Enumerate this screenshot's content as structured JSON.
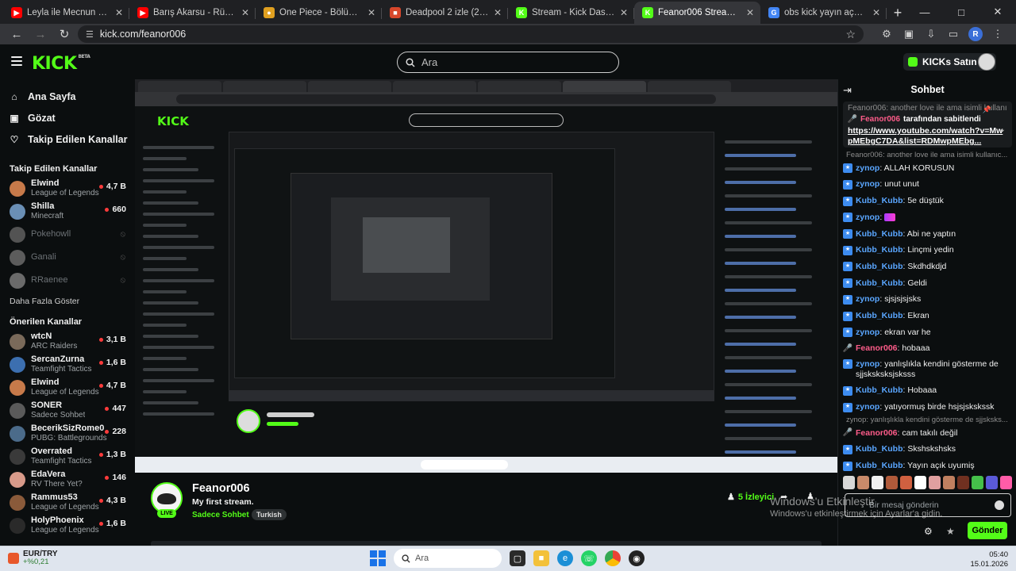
{
  "browser": {
    "tabs": [
      {
        "title": "Leyla ile Mecnun 67. Bölüm - Yo",
        "icon": "youtube",
        "color": "#ff0000"
      },
      {
        "title": "Barış Akarsu - Rüzgar - You",
        "icon": "youtube",
        "color": "#ff0000"
      },
      {
        "title": "One Piece - Bölüm 1170 - Rüyı",
        "icon": "anime",
        "color": "#e0a020"
      },
      {
        "title": "Deadpool 2 izle (2018) | HDFilm",
        "icon": "film",
        "color": "#d8472b"
      },
      {
        "title": "Stream - Kick Dashboard",
        "icon": "kick",
        "color": "#53fc18"
      },
      {
        "title": "Feanor006 Stream - Watch Live",
        "icon": "kick",
        "color": "#53fc18",
        "active": true
      },
      {
        "title": "obs kick yayın açma - Google'd",
        "icon": "google",
        "color": "#4285f4"
      }
    ],
    "url": "kick.com/feanor006",
    "profile_initial": "R"
  },
  "header": {
    "logo": "KICK",
    "logo_beta": "BETA",
    "search_placeholder": "Ara",
    "buy_kicks": "KICKs Satın Al"
  },
  "sidebar": {
    "nav": [
      {
        "label": "Ana Sayfa",
        "icon": "home-icon"
      },
      {
        "label": "Gözat",
        "icon": "browse-icon"
      },
      {
        "label": "Takip Edilen Kanallar",
        "icon": "heart-icon"
      }
    ],
    "followed_header": "Takip Edilen Kanallar",
    "followed": [
      {
        "name": "Elwind",
        "game": "League of Legends",
        "viewers": "4,7 B",
        "color": "#c77a4a"
      },
      {
        "name": "Shilla",
        "game": "Minecraft",
        "viewers": "660",
        "color": "#6a8fb5"
      },
      {
        "name": "Pokehowll",
        "offline": true,
        "color": "#8a8a8a"
      },
      {
        "name": "Ganali",
        "offline": true,
        "color": "#9a9a9a"
      },
      {
        "name": "RRaenee",
        "offline": true,
        "color": "#b0b0b0"
      }
    ],
    "show_more": "Daha Fazla Göster",
    "recommended_header": "Önerilen Kanallar",
    "recommended": [
      {
        "name": "wtcN",
        "game": "ARC Raiders",
        "viewers": "3,1 B",
        "color": "#7a6a5a"
      },
      {
        "name": "SercanZurna",
        "game": "Teamfight Tactics",
        "viewers": "1,6 B",
        "color": "#3c6fb0"
      },
      {
        "name": "Elwind",
        "game": "League of Legends",
        "viewers": "4,7 B",
        "color": "#c77a4a"
      },
      {
        "name": "SONER",
        "game": "Sadece Sohbet",
        "viewers": "447",
        "color": "#5a5a5a"
      },
      {
        "name": "BecerikSizRome0",
        "game": "PUBG: Battlegrounds",
        "viewers": "228",
        "color": "#4b6b8a"
      },
      {
        "name": "Overrated",
        "game": "Teamfight Tactics",
        "viewers": "1,3 B",
        "color": "#3a3a3a"
      },
      {
        "name": "EdaVera",
        "game": "RV There Yet?",
        "viewers": "146",
        "color": "#d89a8a"
      },
      {
        "name": "Rammus53",
        "game": "League of Legends",
        "viewers": "4,3 B",
        "color": "#8a5a3a"
      },
      {
        "name": "HolyPhoenix",
        "game": "League of Legends",
        "viewers": "1,6 B",
        "color": "#2a2a2a"
      }
    ]
  },
  "stream": {
    "streamer": "Feanor006",
    "title": "My first stream.",
    "category": "Sadece Sohbet",
    "tag": "Turkish",
    "live": "LIVE",
    "viewers": "5 İzleyici"
  },
  "chat": {
    "title": "Sohbet",
    "pinned": {
      "reply_preview": "Feanor006: another love ile ama isimli kullanıc...",
      "pinned_by_user": "Feanor006",
      "pinned_by_text": "tarafından sabitlendi",
      "link": "https://www.youtube.com/watch?v=MwpMEbgC7DA&list=RDMwpMEbg..."
    },
    "reply_line_1": "Feanor006: another love ile ama isimli kullanıc...",
    "messages": [
      {
        "user": "zynop",
        "text": "ALLAH KORUSUN",
        "pink": false,
        "mic": false
      },
      {
        "user": "zynop",
        "text": "unut unut",
        "pink": false,
        "mic": false
      },
      {
        "user": "Kubb_Kubb",
        "text": "5e düştük",
        "pink": false,
        "mic": false
      },
      {
        "user": "zynop",
        "text": "",
        "emote": true,
        "pink": false,
        "mic": false
      },
      {
        "user": "Kubb_Kubb",
        "text": "Abi ne yaptın",
        "pink": false,
        "mic": false
      },
      {
        "user": "Kubb_Kubb",
        "text": "Linçmi yedin",
        "pink": false,
        "mic": false
      },
      {
        "user": "Kubb_Kubb",
        "text": "Skdhdkdjd",
        "pink": false,
        "mic": false
      },
      {
        "user": "Kubb_Kubb",
        "text": "Geldi",
        "pink": false,
        "mic": false
      },
      {
        "user": "zynop",
        "text": "sjsjsjsjsks",
        "pink": false,
        "mic": false
      },
      {
        "user": "Kubb_Kubb",
        "text": "Ekran",
        "pink": false,
        "mic": false
      },
      {
        "user": "zynop",
        "text": "ekran var he",
        "pink": false,
        "mic": false
      },
      {
        "user": "Feanor006",
        "text": "hobaaa",
        "pink": true,
        "mic": true
      },
      {
        "user": "zynop",
        "text": "yanlışlıkla kendini gösterme de sjjsksksksjsksss",
        "pink": false,
        "mic": false,
        "multi": true
      },
      {
        "user": "Kubb_Kubb",
        "text": "Hobaaa",
        "pink": false,
        "mic": false
      },
      {
        "user": "zynop",
        "text": "yatıyormuş birde hsjsjskskssk",
        "pink": false,
        "mic": false
      }
    ],
    "reply_line_2": "zynop: yanlışlıkla kendini gösterme de sjjsksks...",
    "messages_after": [
      {
        "user": "Feanor006",
        "text": "cam takılı değil",
        "pink": true,
        "mic": true
      },
      {
        "user": "Kubb_Kubb",
        "text": "Skshskshsks",
        "pink": false,
        "mic": false
      },
      {
        "user": "Kubb_Kubb",
        "text": "Yayın açık uyumiş",
        "pink": false,
        "mic": false
      }
    ],
    "input_placeholder": "Bir mesaj gönderin",
    "send": "Gönder",
    "emote_colors": [
      "#d8d8d8",
      "#c98a6a",
      "#f0f0f0",
      "#b05a3a",
      "#d06040",
      "#ffffff",
      "#e0a0a0",
      "#c08060",
      "#703020",
      "#45c04a",
      "#5a5ad8",
      "#ff5ca8"
    ]
  },
  "watermark": {
    "line1": "Windows'u Etkinleştir",
    "line2": "Windows'u etkinleştirmek için Ayarlar'a gidin."
  },
  "taskbar": {
    "fx_label": "EUR/TRY",
    "fx_value": "+%0,21",
    "search": "Ara",
    "time": "05:40",
    "date": "15.01.2026"
  }
}
